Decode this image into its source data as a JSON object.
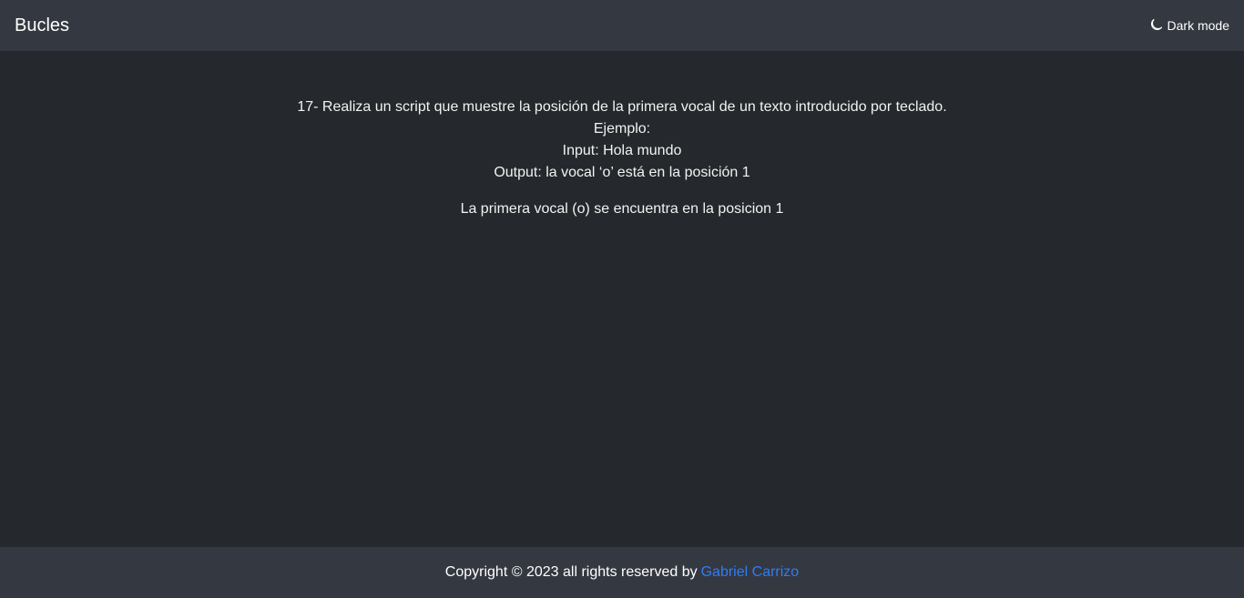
{
  "navbar": {
    "brand": "Bucles",
    "theme_toggle_label": "Dark mode",
    "theme_icon": "moon-icon"
  },
  "exercise": {
    "statement": "17- Realiza un script que muestre la posición de la primera vocal de un texto introducido por teclado.",
    "example_label": "Ejemplo:",
    "input_line": "Input: Hola mundo",
    "output_line": "Output: la vocal ‘o’ está en la posición 1"
  },
  "result": {
    "text": "La primera vocal (o) se encuentra en la posicion 1"
  },
  "footer": {
    "copyright": "Copyright © 2023 all rights reserved by",
    "author_link": "Gabriel Carrizo"
  },
  "colors": {
    "page_background": "#25282c",
    "bar_background": "#343841",
    "link": "#2f7df6"
  }
}
